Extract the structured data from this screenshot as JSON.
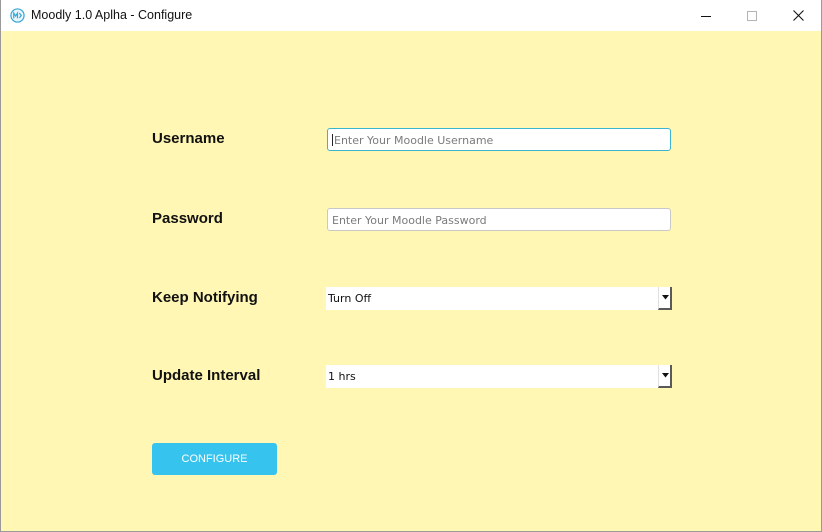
{
  "window": {
    "title": "Moodly 1.0 Aplha - Configure",
    "icon": "moodly-logo-icon",
    "controls": [
      "minimize-icon",
      "maximize-icon",
      "close-icon"
    ]
  },
  "form": {
    "username": {
      "label": "Username",
      "placeholder": "Enter Your Moodle Username",
      "value": ""
    },
    "password": {
      "label": "Password",
      "placeholder": "Enter Your Moodle Password",
      "value": ""
    },
    "keep_notifying": {
      "label": "Keep Notifying",
      "selected": "Turn Off"
    },
    "update_interval": {
      "label": "Update Interval",
      "selected": "1 hrs"
    },
    "configure_button": "CONFIGURE"
  },
  "colors": {
    "background": "#fff7b3",
    "accent": "#36c3ee",
    "focus_border": "#3cb4ce"
  }
}
